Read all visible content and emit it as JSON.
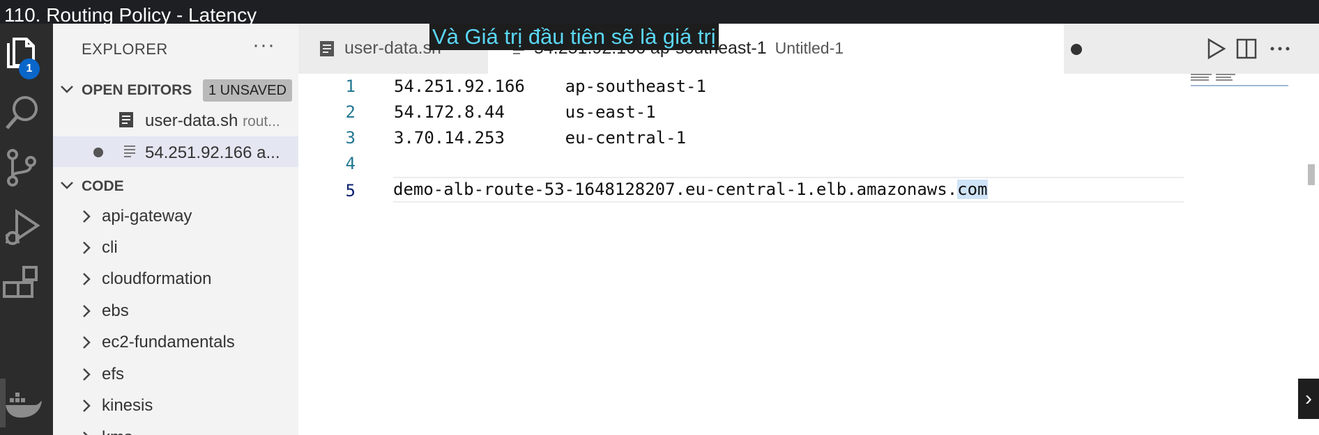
{
  "video": {
    "title": "110. Routing Policy - Latency"
  },
  "subtitle": "Và Giá trị đầu tiên sẽ là giá trị",
  "activity_bar": {
    "explorer_badge": "1",
    "icons": [
      "files-icon",
      "search-icon",
      "source-control-icon",
      "run-debug-icon",
      "extensions-icon",
      "docker-icon"
    ]
  },
  "sidebar": {
    "title": "EXPLORER",
    "more": "···",
    "open_editors": {
      "label": "OPEN EDITORS",
      "badge": "1 UNSAVED",
      "items": [
        {
          "name": "user-data.sh",
          "desc": "rout..."
        },
        {
          "name": "54.251.92.166 a..."
        }
      ]
    },
    "code": {
      "label": "CODE",
      "folders": [
        "api-gateway",
        "cli",
        "cloudformation",
        "ebs",
        "ec2-fundamentals",
        "efs",
        "kinesis",
        "kms"
      ]
    }
  },
  "tabs": [
    {
      "label": "user-data.sh"
    },
    {
      "label": "54.251.92.166 ap-southeast-1",
      "desc": "Untitled-1"
    }
  ],
  "editor": {
    "lines": [
      {
        "num": "1",
        "text": "54.251.92.166    ap-southeast-1"
      },
      {
        "num": "2",
        "text": "54.172.8.44      us-east-1"
      },
      {
        "num": "3",
        "text": "3.70.14.253      eu-central-1"
      },
      {
        "num": "4",
        "text": ""
      },
      {
        "num": "5",
        "text_before": "demo-alb-route-53-1648128207.eu-central-1.elb.amazonaws.",
        "text_selected": "com"
      }
    ]
  },
  "colors": {
    "accent": "#0a66c9",
    "subtitle": "#5ad7f5",
    "activity_bar": "#2c2c2c",
    "sidebar": "#f3f3f3"
  }
}
